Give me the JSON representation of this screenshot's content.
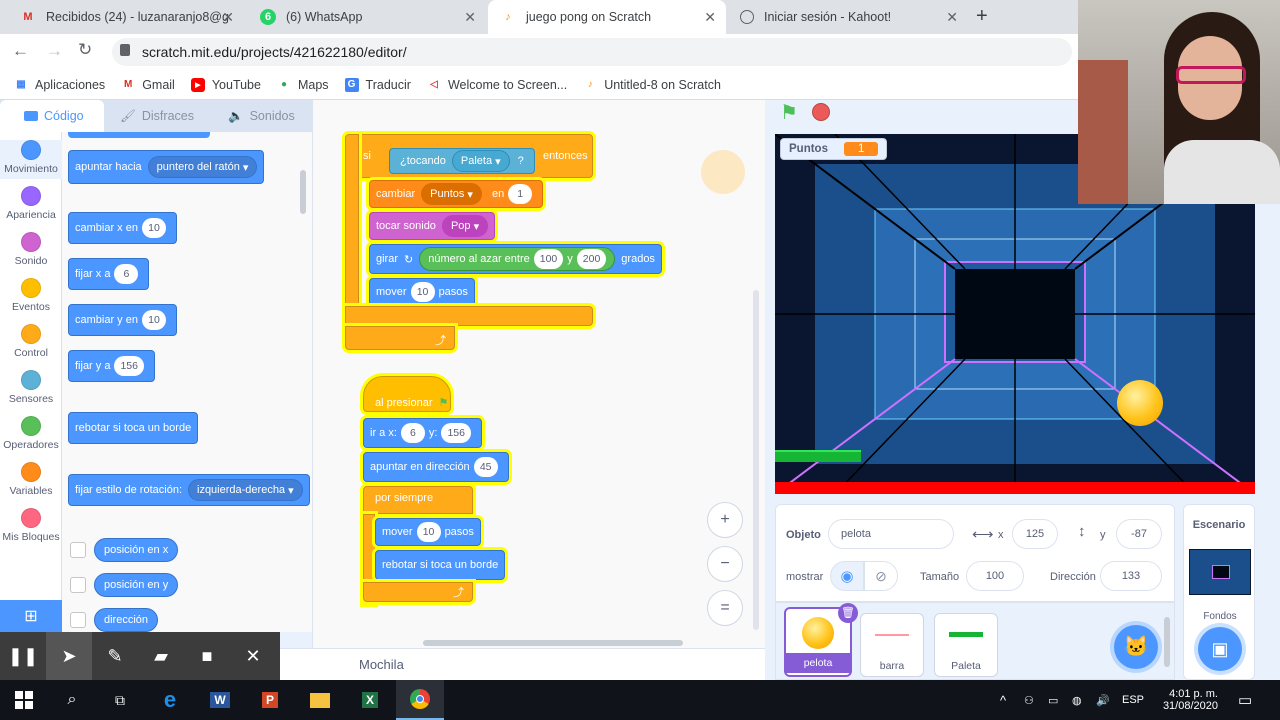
{
  "browser": {
    "tabs": [
      {
        "label": "Recibidos (24) - luzanaranjo8@g",
        "icon": "gmail-icon",
        "active": false
      },
      {
        "label": "(6) WhatsApp",
        "icon": "whatsapp-icon",
        "active": false
      },
      {
        "label": "juego pong on Scratch",
        "icon": "scratch-icon",
        "active": true
      },
      {
        "label": "Iniciar sesión - Kahoot!",
        "icon": "globe-icon",
        "active": false
      }
    ],
    "new_tab": "+",
    "url": "scratch.mit.edu/projects/421622180/editor/",
    "bookmarks": [
      {
        "label": "Aplicaciones",
        "icon": "apps-grid-icon"
      },
      {
        "label": "Gmail",
        "icon": "gmail-icon"
      },
      {
        "label": "YouTube",
        "icon": "youtube-icon"
      },
      {
        "label": "Maps",
        "icon": "maps-pin-icon"
      },
      {
        "label": "Traducir",
        "icon": "translate-icon"
      },
      {
        "label": "Welcome to Screen...",
        "icon": "screencast-icon"
      },
      {
        "label": "Untitled-8 on Scratch",
        "icon": "scratch-icon"
      }
    ]
  },
  "editor": {
    "tabs": {
      "code": "Código",
      "costumes": "Disfraces",
      "sounds": "Sonidos"
    },
    "categories": [
      {
        "label": "Movimiento",
        "color": "#4c97ff"
      },
      {
        "label": "Apariencia",
        "color": "#9966ff"
      },
      {
        "label": "Sonido",
        "color": "#cf63cf"
      },
      {
        "label": "Eventos",
        "color": "#ffbf00"
      },
      {
        "label": "Control",
        "color": "#ffab19"
      },
      {
        "label": "Sensores",
        "color": "#5cb1d6"
      },
      {
        "label": "Operadores",
        "color": "#59c059"
      },
      {
        "label": "Variables",
        "color": "#ff8c1a"
      },
      {
        "label": "Mis Bloques",
        "color": "#ff6680"
      }
    ],
    "palette": {
      "point_towards": "apuntar hacia",
      "point_towards_target": "puntero del ratón",
      "change_x": "cambiar x en",
      "change_x_val": "10",
      "set_x": "fijar x a",
      "set_x_val": "6",
      "change_y": "cambiar y en",
      "change_y_val": "10",
      "set_y": "fijar y a",
      "set_y_val": "156",
      "bounce": "rebotar si toca un borde",
      "rotation_style": "fijar estilo de rotación:",
      "rotation_style_val": "izquierda-derecha",
      "x_position": "posición en x",
      "y_position": "posición en y",
      "direction": "dirección"
    },
    "script1": {
      "if": "si",
      "touching": "¿tocando",
      "touching_target": "Paleta",
      "question": "?",
      "then": "entonces",
      "change": "cambiar",
      "var": "Puntos",
      "by": "en",
      "by_val": "1",
      "play_sound": "tocar sonido",
      "sound": "Pop",
      "turn": "girar",
      "random": "número al azar entre",
      "rand_from": "100",
      "rand_and": "y",
      "rand_to": "200",
      "degrees": "grados",
      "move": "mover",
      "move_val": "10",
      "steps": "pasos"
    },
    "script2": {
      "when_flag": "al presionar",
      "goto": "ir a x:",
      "goto_x": "6",
      "goto_y_label": "y:",
      "goto_y": "156",
      "point_dir": "apuntar en dirección",
      "point_dir_val": "45",
      "forever": "por siempre",
      "move": "mover",
      "move_val": "10",
      "steps": "pasos",
      "bounce": "rebotar si toca un borde"
    },
    "backpack": "Mochila",
    "zoom": {
      "in": "+",
      "out": "−",
      "reset": "="
    }
  },
  "stage": {
    "monitor_label": "Puntos",
    "monitor_value": "1"
  },
  "sprite_info": {
    "sprite_label": "Objeto",
    "sprite_name": "pelota",
    "x_label": "x",
    "x_val": "125",
    "y_label": "y",
    "y_val": "-87",
    "show_label": "mostrar",
    "size_label": "Tamaño",
    "size_val": "100",
    "direction_label": "Dirección",
    "direction_val": "133"
  },
  "sprites": [
    {
      "name": "pelota",
      "selected": true
    },
    {
      "name": "barra",
      "selected": false
    },
    {
      "name": "Paleta",
      "selected": false
    }
  ],
  "stage_pane": {
    "title": "Escenario",
    "backdrops": "Fondos"
  },
  "taskbar": {
    "lang": "ESP",
    "time": "4:01 p. m.",
    "date": "31/08/2020"
  },
  "colors": {
    "scratch_blue": "#4c97ff",
    "scratch_purple": "#855cd6",
    "control": "#ffab19",
    "variables": "#ff8c1a"
  }
}
